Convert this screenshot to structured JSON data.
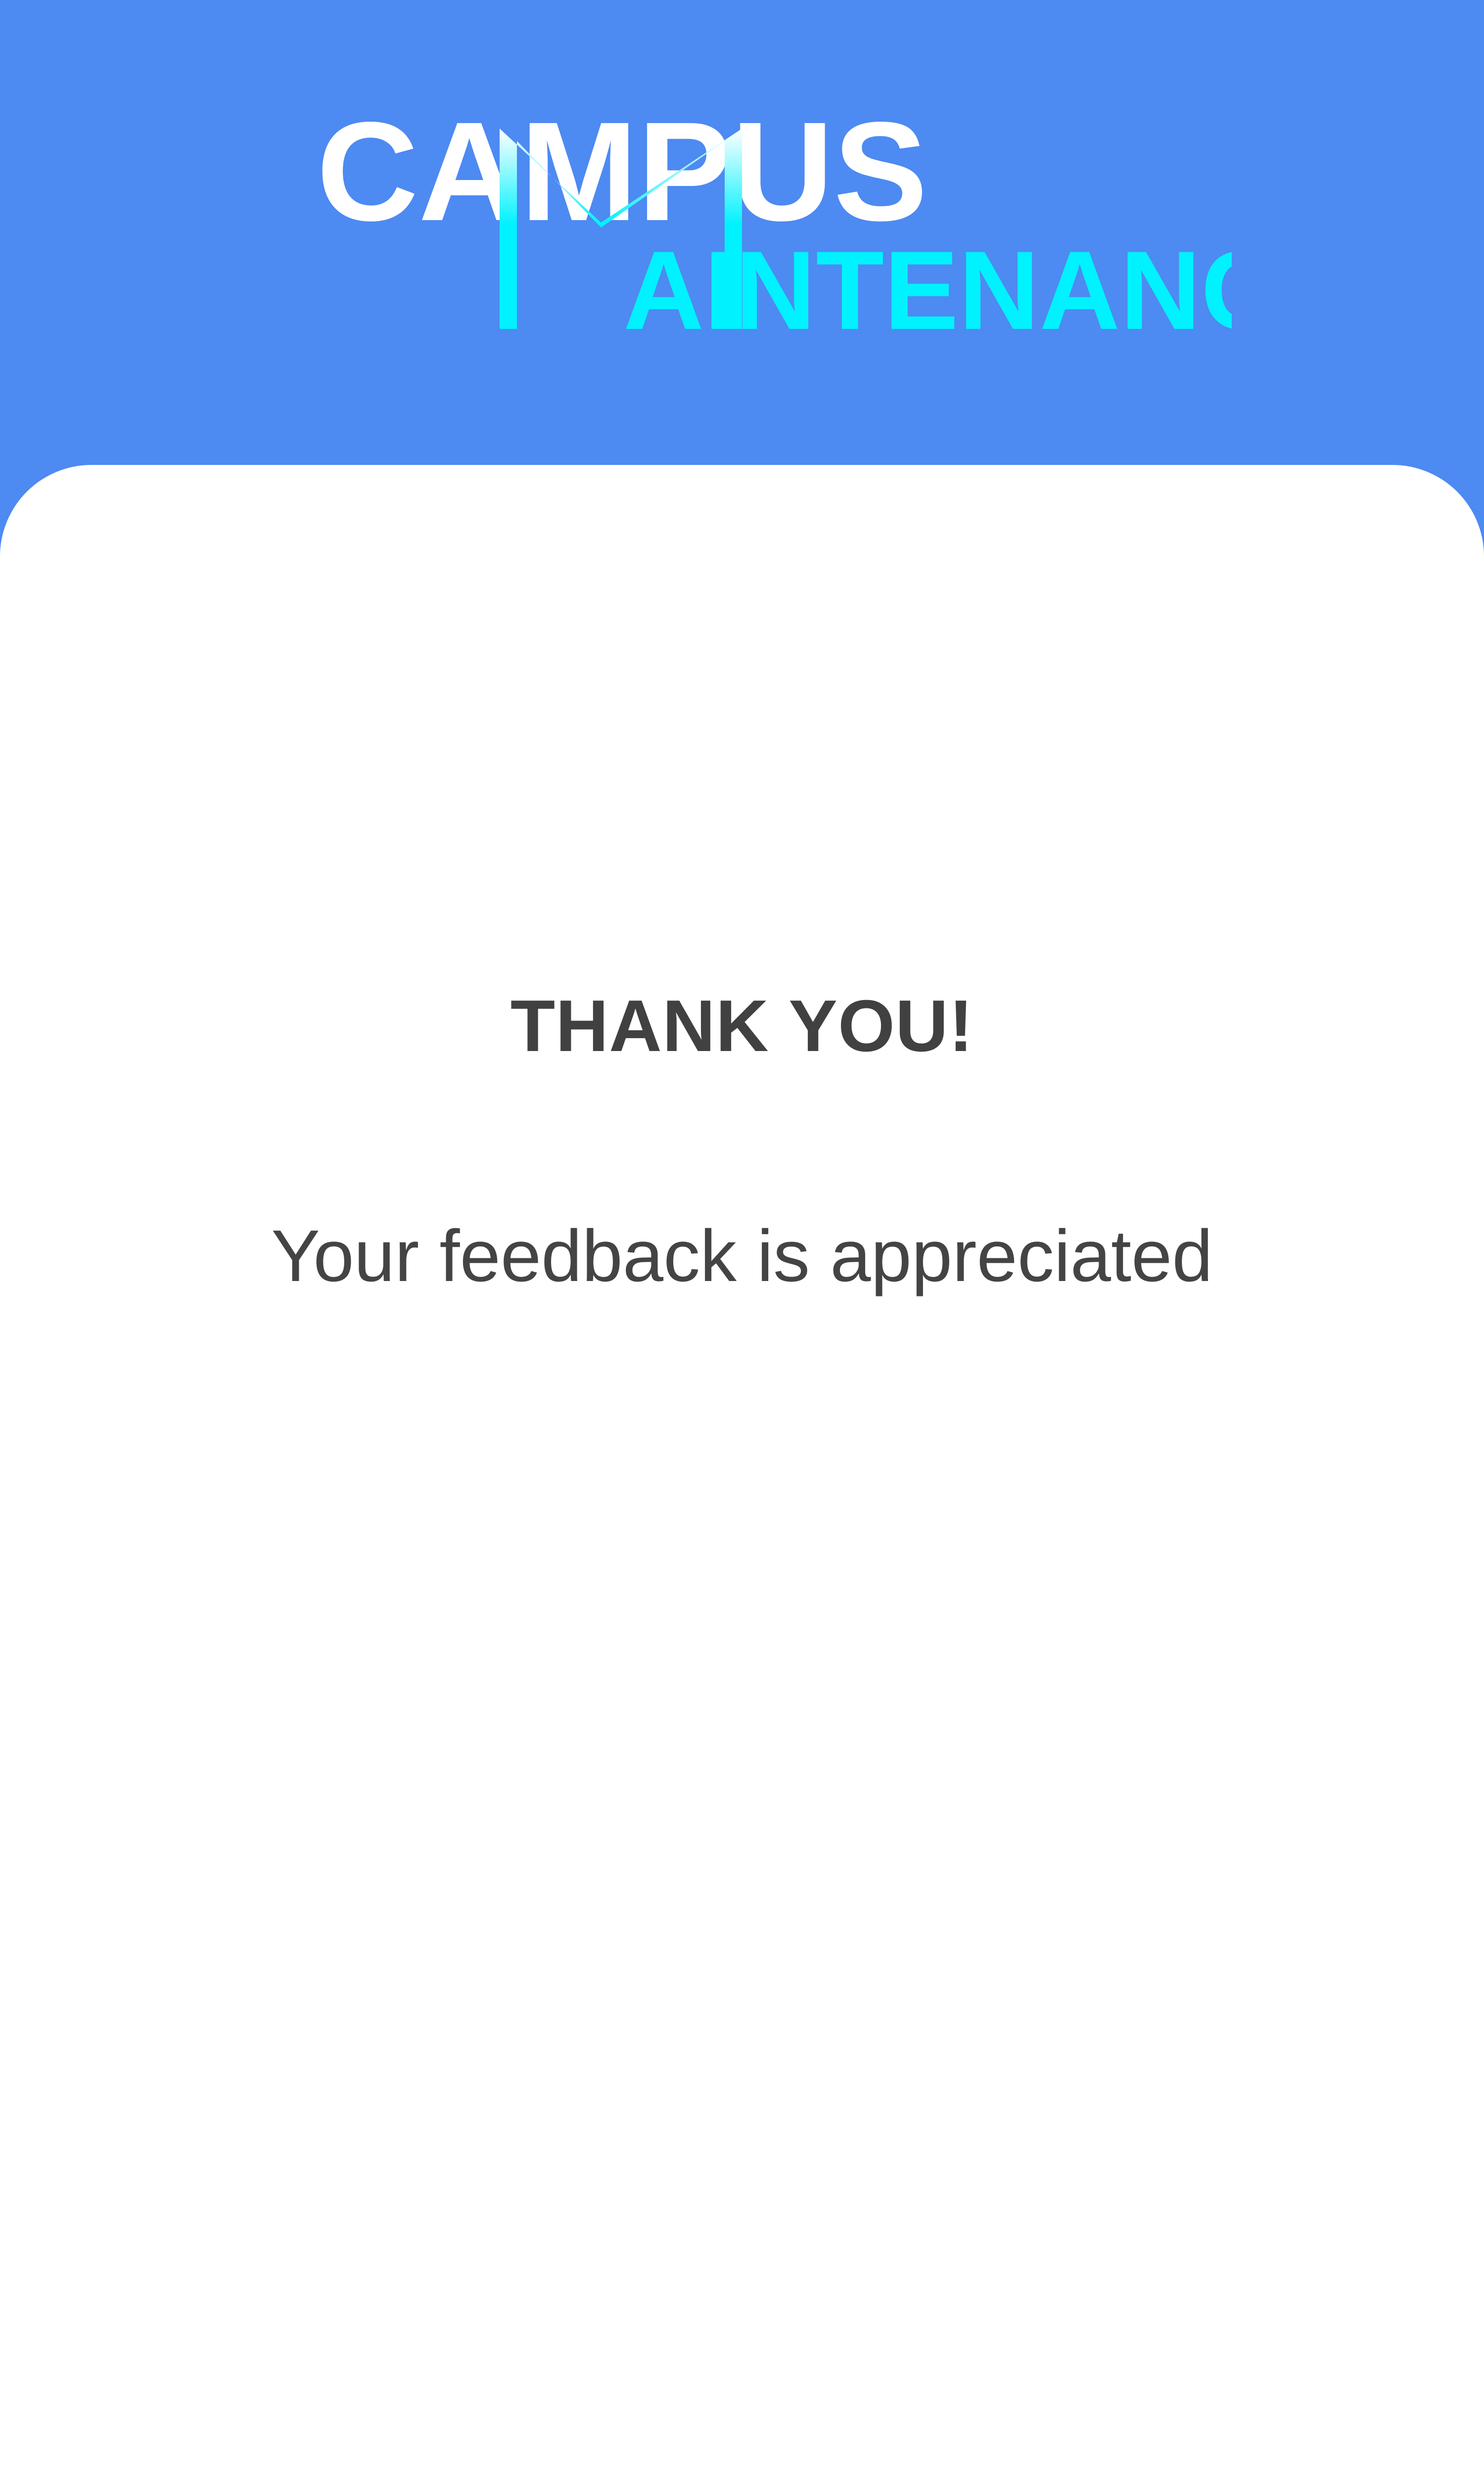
{
  "logo": {
    "line1": "CAMPUS",
    "line2_initial": "M",
    "line2_rest": "AINTENANCE",
    "colors": {
      "primary": "#ffffff",
      "accent": "#00f2ff"
    }
  },
  "message": {
    "title": "THANK YOU!",
    "subtitle": "Your feedback is appreciated"
  },
  "colors": {
    "header_background": "#4d8af2",
    "card_background": "#ffffff",
    "text": "#414141"
  }
}
